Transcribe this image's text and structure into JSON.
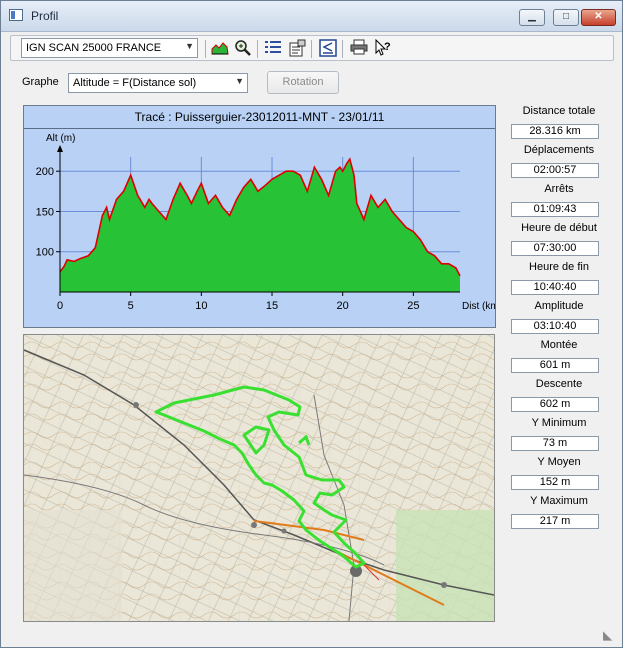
{
  "window": {
    "title": "Profil",
    "minimize": "▁",
    "maximize": "□",
    "close": "✕"
  },
  "toolbar": {
    "map_source": "IGN SCAN 25000 FRANCE",
    "icons": [
      "profile-chart-icon",
      "zoom-icon",
      "list-icon",
      "properties-icon",
      "export-icon",
      "print-icon",
      "help-icon"
    ]
  },
  "graph": {
    "label": "Graphe",
    "selected": "Altitude = F(Distance sol)",
    "rotation_label": "Rotation"
  },
  "chart": {
    "title": "Tracé : Puisserguier-23012011-MNT - 23/01/11"
  },
  "stats": [
    {
      "label": "Distance totale",
      "value": "28.316 km"
    },
    {
      "label": "Déplacements",
      "value": "02:00:57"
    },
    {
      "label": "Arrêts",
      "value": "01:09:43"
    },
    {
      "label": "Heure de début",
      "value": "07:30:00"
    },
    {
      "label": "Heure de fin",
      "value": "10:40:40"
    },
    {
      "label": "Amplitude",
      "value": "03:10:40"
    },
    {
      "label": "Montée",
      "value": "601 m"
    },
    {
      "label": "Descente",
      "value": "602 m"
    },
    {
      "label": "Y Minimum",
      "value": "73 m"
    },
    {
      "label": "Y Moyen",
      "value": "152 m"
    },
    {
      "label": "Y Maximum",
      "value": "217 m"
    }
  ],
  "chart_data": {
    "type": "area",
    "title": "Tracé : Puisserguier-23012011-MNT - 23/01/11",
    "xlabel": "Dist (km)",
    "ylabel": "Alt (m)",
    "xlim": [
      0,
      28.3
    ],
    "ylim": [
      50,
      240
    ],
    "xticks": [
      0,
      5,
      10,
      15,
      20,
      25
    ],
    "yticks": [
      100,
      150,
      200
    ],
    "grid": true,
    "series": [
      {
        "color": "#27c235",
        "line_color": "#e00000",
        "x": [
          0,
          0.3,
          0.5,
          1,
          1.5,
          2,
          2.5,
          3,
          3.3,
          3.5,
          4,
          4.5,
          5,
          5.5,
          6,
          6.3,
          6.5,
          7,
          7.5,
          8,
          8.5,
          9,
          9.3,
          9.7,
          10,
          10.5,
          11,
          11.5,
          12,
          12.5,
          13,
          13.5,
          14,
          14.5,
          15,
          15.5,
          16,
          16.5,
          17,
          17.5,
          18,
          18.5,
          19,
          19.5,
          19.8,
          20,
          20.3,
          20.5,
          20.8,
          21,
          21.5,
          22,
          22.5,
          23,
          23.5,
          24,
          24.5,
          25,
          25.5,
          26,
          26.5,
          27,
          27.5,
          28,
          28.3
        ],
        "y": [
          75,
          82,
          90,
          88,
          92,
          95,
          105,
          145,
          155,
          140,
          165,
          175,
          195,
          170,
          155,
          165,
          160,
          150,
          140,
          165,
          185,
          170,
          160,
          175,
          185,
          160,
          170,
          155,
          145,
          165,
          180,
          190,
          175,
          182,
          190,
          195,
          200,
          200,
          195,
          175,
          205,
          190,
          170,
          200,
          205,
          200,
          210,
          215,
          195,
          160,
          140,
          170,
          155,
          165,
          150,
          140,
          130,
          125,
          115,
          100,
          95,
          85,
          85,
          80,
          70
        ]
      }
    ]
  }
}
